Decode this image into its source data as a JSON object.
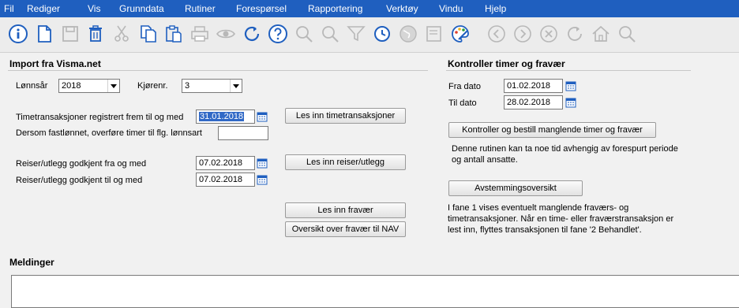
{
  "menu": [
    "Fil",
    "Rediger",
    "Vis",
    "Grunndata",
    "Rutiner",
    "Forespørsel",
    "Rapportering",
    "Verktøy",
    "Vindu",
    "Hjelp"
  ],
  "toolbar_icons": [
    "info-icon",
    "new-document-icon",
    "save-icon",
    "delete-icon",
    "cut-icon",
    "copy-icon",
    "paste-icon",
    "print-icon",
    "preview-icon",
    "refresh-icon",
    "help-icon",
    "search-icon",
    "filter-icon",
    "history-icon",
    "globe-icon",
    "note-icon",
    "palette-icon",
    "back-icon",
    "forward-icon",
    "stop-icon",
    "reload-icon",
    "home-icon",
    "find-icon"
  ],
  "import": {
    "title": "Import fra Visma.net",
    "lonnsar_label": "Lønnsår",
    "lonnsar_value": "2018",
    "kjorenr_label": "Kjørenr.",
    "kjorenr_value": "3",
    "timetrans_label": "Timetransaksjoner registrert frem til og med",
    "timetrans_value": "31.01.2018",
    "fastlonnet_label": "Dersom fastlønnet, overføre timer til flg. lønnsart",
    "fastlonnet_value": "",
    "reiser_fra_label": "Reiser/utlegg godkjent fra og med",
    "reiser_fra_value": "07.02.2018",
    "reiser_til_label": "Reiser/utlegg godkjent til og med",
    "reiser_til_value": "07.02.2018",
    "btn_timetrans": "Les inn timetransaksjoner",
    "btn_reiser": "Les inn reiser/utlegg",
    "btn_fravaer": "Les inn fravær",
    "btn_oversikt": "Oversikt over fravær til NAV"
  },
  "kontroll": {
    "title": "Kontroller timer og fravær",
    "fra_label": "Fra dato",
    "fra_value": "01.02.2018",
    "til_label": "Til dato",
    "til_value": "28.02.2018",
    "btn_kontroller": "Kontroller og bestill manglende timer og fravær",
    "info1": "Denne rutinen kan ta noe tid avhengig av forespurt periode og antall ansatte.",
    "btn_avstemming": "Avstemmingsoversikt",
    "info2": "I fane 1 vises eventuelt manglende fraværs- og timetransaksjoner. Når en time- eller fraværstransaksjon er lest inn, flyttes transaksjonen til fane '2 Behandlet'."
  },
  "meldinger": {
    "title": "Meldinger"
  }
}
